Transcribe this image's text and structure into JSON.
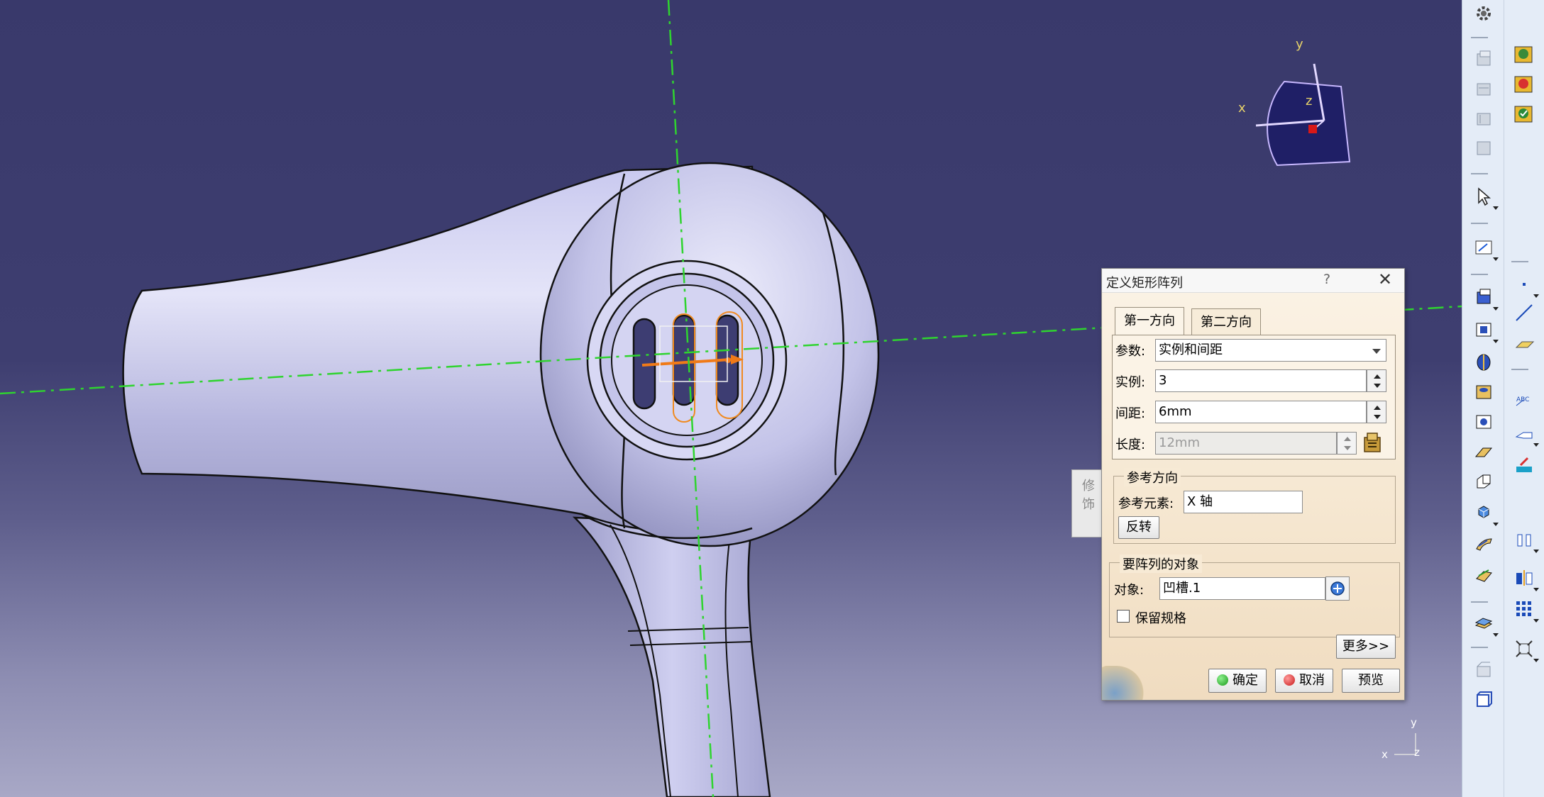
{
  "compass": {
    "x_label": "x",
    "y_label": "y",
    "z_label": "z"
  },
  "mini_axis": {
    "x_label": "x",
    "y_label": "y",
    "z_label": "z"
  },
  "background_window": {
    "title": "修饰"
  },
  "dialog": {
    "title": "定义矩形阵列",
    "help_glyph": "?",
    "close_glyph": "✕",
    "tabs": [
      {
        "label": "第一方向",
        "active": true
      },
      {
        "label": "第二方向",
        "active": false
      }
    ],
    "params": {
      "parameters_label": "参数:",
      "parameters_value": "实例和间距",
      "instances_label": "实例:",
      "instances_value": "3",
      "spacing_label": "间距:",
      "spacing_value": "6mm",
      "length_label": "长度:",
      "length_value": "12mm"
    },
    "reference_direction": {
      "group_title": "参考方向",
      "element_label": "参考元素:",
      "element_value": "X 轴",
      "reverse_button": "反转"
    },
    "object_to_pattern": {
      "group_title": "要阵列的对象",
      "object_label": "对象:",
      "object_value": "凹槽.1",
      "keep_spec_label": "保留规格",
      "keep_spec_checked": false
    },
    "more_button": "更多>>",
    "ok_button": "确定",
    "cancel_button": "取消",
    "preview_button": "预览"
  },
  "toolbar": {
    "left_icons": [
      "settings-icon",
      "assembly-icon",
      "constraint-icon",
      "catalog-icon",
      "table-icon",
      "select-arrow-icon",
      "sketch-icon",
      "pad-icon",
      "pocket-icon",
      "shaft-icon",
      "hole-icon",
      "groove-icon",
      "rib-icon",
      "slot-icon",
      "solid-combine-icon",
      "stiffener-icon",
      "loft-icon",
      "thickness-icon",
      "surface-icon",
      "boolean-icon",
      "axis-system-icon"
    ],
    "right_icons": [
      "light-bulb-icon",
      "material-icon",
      "apply-icon",
      "point-icon",
      "line-icon",
      "plane-icon",
      "text-icon",
      "annotation-icon",
      "measure-icon",
      "analysis-icon",
      "mirror-icon",
      "rectangular-pattern-icon",
      "scale-icon"
    ]
  }
}
